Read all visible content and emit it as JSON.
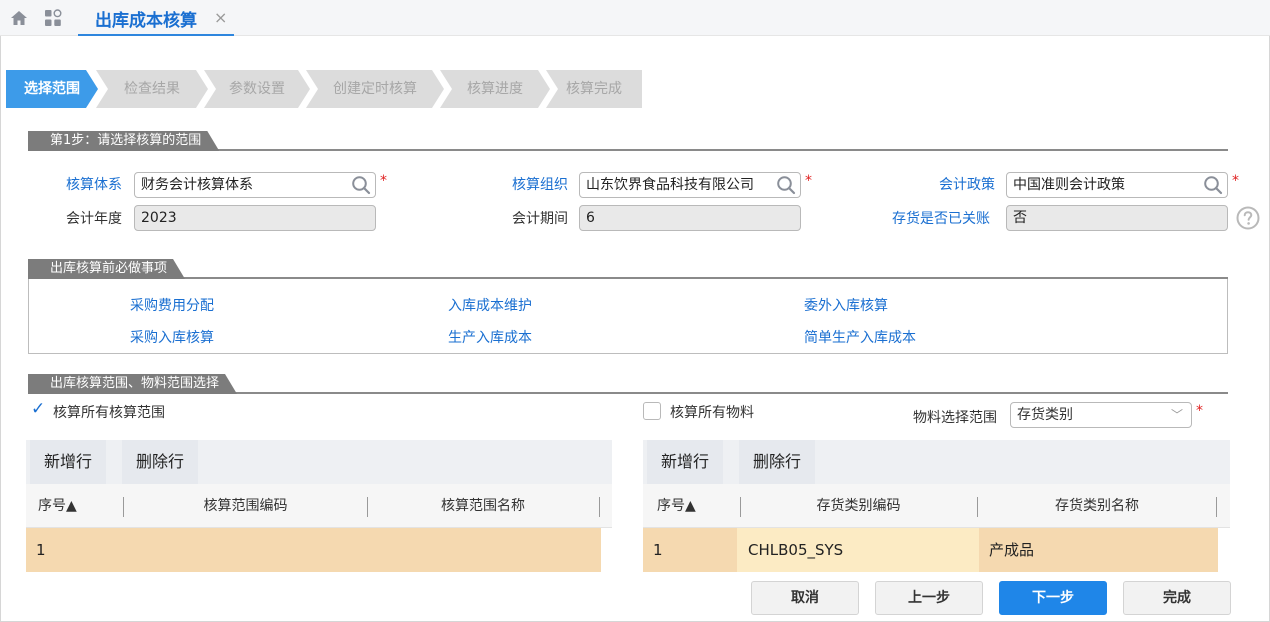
{
  "tab": {
    "title": "出库成本核算",
    "close": "×"
  },
  "steps": [
    "选择范围",
    "检查结果",
    "参数设置",
    "创建定时核算",
    "核算进度",
    "核算完成"
  ],
  "sections": {
    "range": "第1步：请选择核算的范围",
    "pre": "出库核算前必做事项",
    "scope": "出库核算范围、物料范围选择"
  },
  "form": {
    "system_label": "核算体系",
    "system_value": "财务会计核算体系",
    "org_label": "核算组织",
    "org_value": "山东饮界食品科技有限公司",
    "policy_label": "会计政策",
    "policy_value": "中国准则会计政策",
    "year_label": "会计年度",
    "year_value": "2023",
    "period_label": "会计期间",
    "period_value": "6",
    "closed_label": "存货是否已关账",
    "closed_value": "否",
    "required_mark": "*"
  },
  "pre_tasks": [
    "采购费用分配",
    "入库成本维护",
    "委外入库核算",
    "采购入库核算",
    "生产入库成本",
    "简单生产入库成本"
  ],
  "checks": {
    "all_scope": "核算所有核算范围",
    "all_scope_checked": true,
    "all_material": "核算所有物料",
    "all_material_checked": false,
    "check_mark": "✓",
    "material_range_label": "物料选择范围",
    "material_range_value": "存货类别"
  },
  "left_grid": {
    "add": "新增行",
    "delete": "删除行",
    "columns": [
      "序号▲",
      "核算范围编码",
      "核算范围名称"
    ],
    "rows": [
      [
        "1",
        "",
        ""
      ]
    ]
  },
  "right_grid": {
    "add": "新增行",
    "delete": "删除行",
    "columns": [
      "序号▲",
      "存货类别编码",
      "存货类别名称"
    ],
    "rows": [
      [
        "1",
        "CHLB05_SYS",
        "产成品"
      ]
    ]
  },
  "footer": {
    "cancel": "取消",
    "prev": "上一步",
    "next": "下一步",
    "finish": "完成"
  },
  "colors": {
    "accent": "#1f86e8",
    "link": "#1a6fd1",
    "active_step": "#3d9be9",
    "row_highlight": "#f5d9b0"
  }
}
